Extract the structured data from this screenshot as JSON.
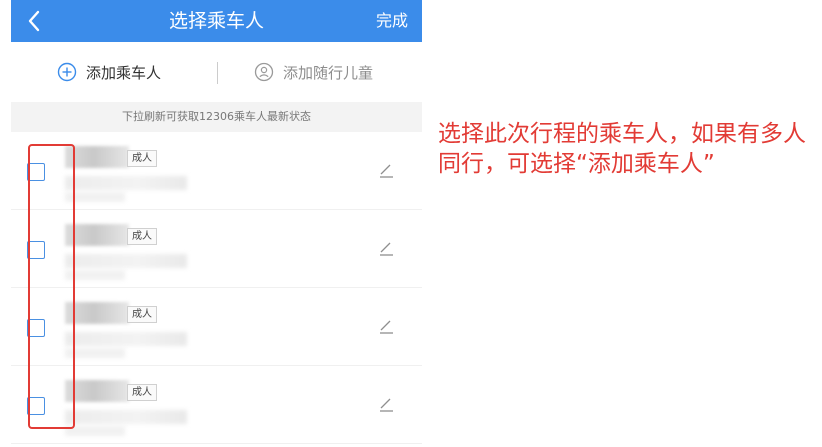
{
  "header": {
    "back_label": "<",
    "title": "选择乘车人",
    "done_label": "完成",
    "color": "#3b8cea"
  },
  "actions": {
    "add_passenger": "添加乘车人",
    "add_child": "添加随行儿童"
  },
  "refresh_banner": "下拉刷新可获取12306乘车人最新状态",
  "passengers": [
    {
      "type_label": "成人"
    },
    {
      "type_label": "成人"
    },
    {
      "type_label": "成人"
    },
    {
      "type_label": "成人"
    }
  ],
  "annotation": {
    "text": "选择此次行程的乘车人，如果有多人同行，可选择“添加乘车人”",
    "color": "#e23b35"
  }
}
